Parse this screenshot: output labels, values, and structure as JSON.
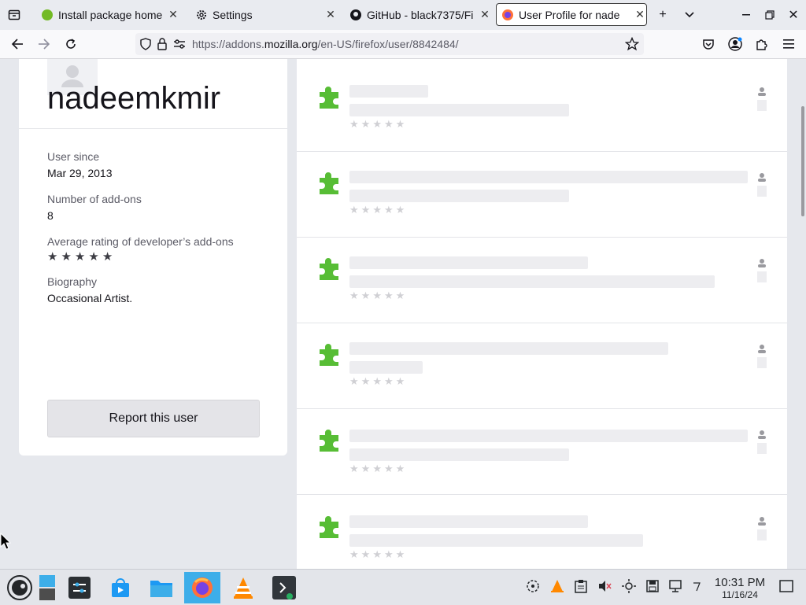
{
  "tabs": [
    {
      "label": "Install package home",
      "icon": "opensuse-icon"
    },
    {
      "label": "Settings",
      "icon": "gear-icon"
    },
    {
      "label": "GitHub - black7375/Fi",
      "icon": "github-icon"
    },
    {
      "label": "User Profile for nade",
      "icon": "firefox-icon",
      "active": true
    }
  ],
  "url": {
    "prefix": "https://addons.",
    "host": "mozilla.org",
    "path": "/en-US/firefox/user/8842484/"
  },
  "profile": {
    "username": "nadeemkmir",
    "user_since_label": "User since",
    "user_since_value": "Mar 29, 2013",
    "addons_count_label": "Number of add-ons",
    "addons_count_value": "8",
    "avg_rating_label": "Average rating of developer’s add-ons",
    "biography_label": "Biography",
    "biography_value": "Occasional Artist.",
    "report_button": "Report this user"
  },
  "colors": {
    "accent": "#3daee9",
    "puzzle_green": "#57bd35"
  },
  "taskbar": {
    "apps": [
      "menu-icon",
      "desktop-pager-icon",
      "settings-icon",
      "discover-store-icon",
      "file-manager-icon",
      "firefox-icon",
      "vlc-icon",
      "terminal-icon"
    ],
    "time": "10:31 PM",
    "date": "11/16/24"
  }
}
